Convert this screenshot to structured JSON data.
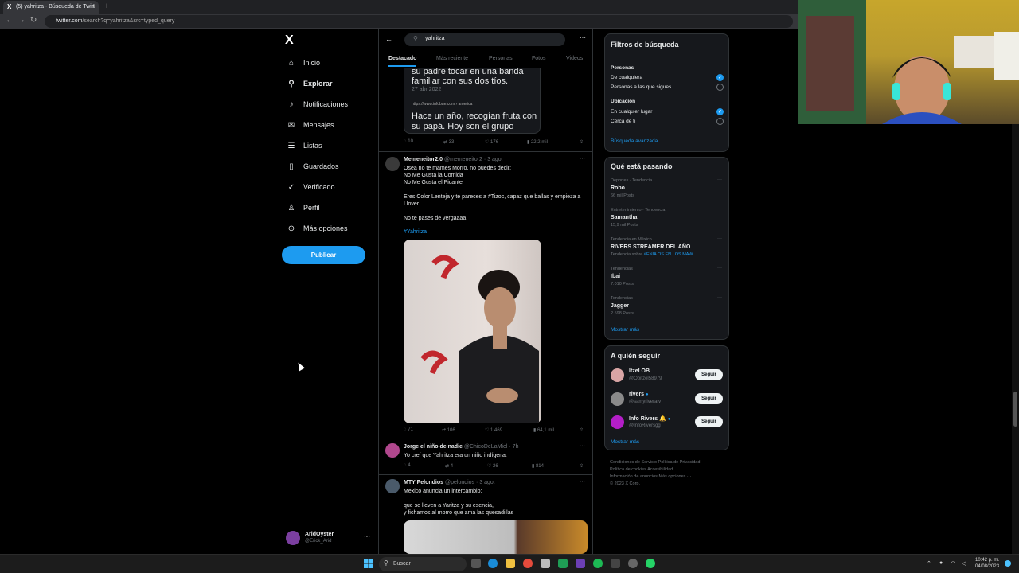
{
  "browser": {
    "tab_title": "(5) yahritza - Búsqueda de Twitt",
    "tab_favicon": "X",
    "url_host": "twitter.com",
    "url_path": "/search?q=yahritza&src=typed_query"
  },
  "sidebar": {
    "logo": "X",
    "items": [
      {
        "label": "Inicio",
        "icon": "home-icon"
      },
      {
        "label": "Explorar",
        "icon": "search-icon"
      },
      {
        "label": "Notificaciones",
        "icon": "bell-icon"
      },
      {
        "label": "Mensajes",
        "icon": "mail-icon"
      },
      {
        "label": "Listas",
        "icon": "list-icon"
      },
      {
        "label": "Guardados",
        "icon": "bookmark-icon"
      },
      {
        "label": "Verificado",
        "icon": "verified-icon"
      },
      {
        "label": "Perfil",
        "icon": "person-icon"
      },
      {
        "label": "Más opciones",
        "icon": "more-circle-icon"
      }
    ],
    "publish": "Publicar",
    "account": {
      "name": "AridOyster",
      "handle": "@Erick_Arid"
    }
  },
  "search": {
    "query": "yahritza",
    "tabs": [
      "Destacado",
      "Más reciente",
      "Personas",
      "Fotos",
      "Videos"
    ]
  },
  "feed": {
    "preview_card": {
      "text_top": "su padre tocar en una banda familiar con sus dos tíos.",
      "date": "27 abr 2022",
      "source": "https://www.infobae.com › america",
      "text_bottom": "Hace un año, recogían fruta con su papá. Hoy son el grupo"
    },
    "tweets": [
      {
        "name": "Memeneitor2.0",
        "handle": "@memeneitor2",
        "time": "3 ago.",
        "text": "Osea no te mames Morro, no puedes decir:\nNo Me Gusta la Comida\nNo Me Gusta el Picante\n\nEres Color Lenteja y te pareces a #Tizoc, capaz que ballas y empieza a Llover.\n\nNo te pases de vergaaaa",
        "hashtag": "#Yahritza",
        "stats": {
          "replies": "71",
          "retweets": "106",
          "likes": "1,469",
          "views": "64,1 mil"
        }
      },
      {
        "name": "Jorge el niño de nadie",
        "handle": "@ChicoDeLaMiel",
        "time": "7h",
        "text": "Yo creí que Yahritza era un niño indígena.",
        "stats": {
          "replies": "4",
          "retweets": "4",
          "likes": "26",
          "views": "814"
        }
      },
      {
        "name": "MTY Pelondios",
        "handle": "@pelondios",
        "time": "3 ago.",
        "text": "Mexico anuncia un intercambio:\n\nque se lleven a Yaritza y su esencia,\ny fichamos al morro que ama las quesadillas"
      }
    ],
    "first_stats": {
      "replies": "10",
      "retweets": "33",
      "likes": "176",
      "views": "22,2 mil"
    }
  },
  "filters": {
    "title": "Filtros de búsqueda",
    "people_label": "Personas",
    "people_options": [
      "De cualquiera",
      "Personas a las que sigues"
    ],
    "location_label": "Ubicación",
    "location_options": [
      "En cualquier lugar",
      "Cerca de ti"
    ],
    "advanced": "Búsqueda avanzada"
  },
  "trends": {
    "title": "Qué está pasando",
    "items": [
      {
        "category": "Deportes · Tendencia",
        "name": "Robo",
        "count": "66 mil Posts"
      },
      {
        "category": "Entretenimiento · Tendencia",
        "name": "Samantha",
        "count": "15,9 mil Posts"
      },
      {
        "category": "Tendencia en México",
        "name": "RIVERS STREAMER DEL AÑO",
        "count": "Tendencia sobre",
        "tag": "#ENIA OS EN LOS MAW"
      },
      {
        "category": "Tendencias",
        "name": "Ibai",
        "count": "7.010 Posts"
      },
      {
        "category": "Tendencias",
        "name": "Jagger",
        "count": "2.598 Posts"
      }
    ],
    "show_more": "Mostrar más"
  },
  "who_to_follow": {
    "title": "A quién seguir",
    "items": [
      {
        "name": "Itzel OB",
        "handle": "@Obitzel58979",
        "verified": false
      },
      {
        "name": "rivers",
        "handle": "@samyriveratv",
        "verified": true
      },
      {
        "name": "Info Rivers 🔔",
        "handle": "@InfoRiversgg",
        "verified": true
      }
    ],
    "follow_label": "Seguir",
    "show_more": "Mostrar más"
  },
  "footer": {
    "lines": [
      "Condiciones de Servicio   Política de Privacidad",
      "Política de cookies   Accesibilidad",
      "Información de anuncios   Más opciones ···",
      "© 2023 X Corp."
    ]
  },
  "taskbar": {
    "search_label": "Buscar",
    "time": "10:42 p. m.",
    "date": "04/08/2023"
  },
  "colors": {
    "accent": "#1d9bf0",
    "background": "#000000",
    "panel": "#16181c"
  }
}
